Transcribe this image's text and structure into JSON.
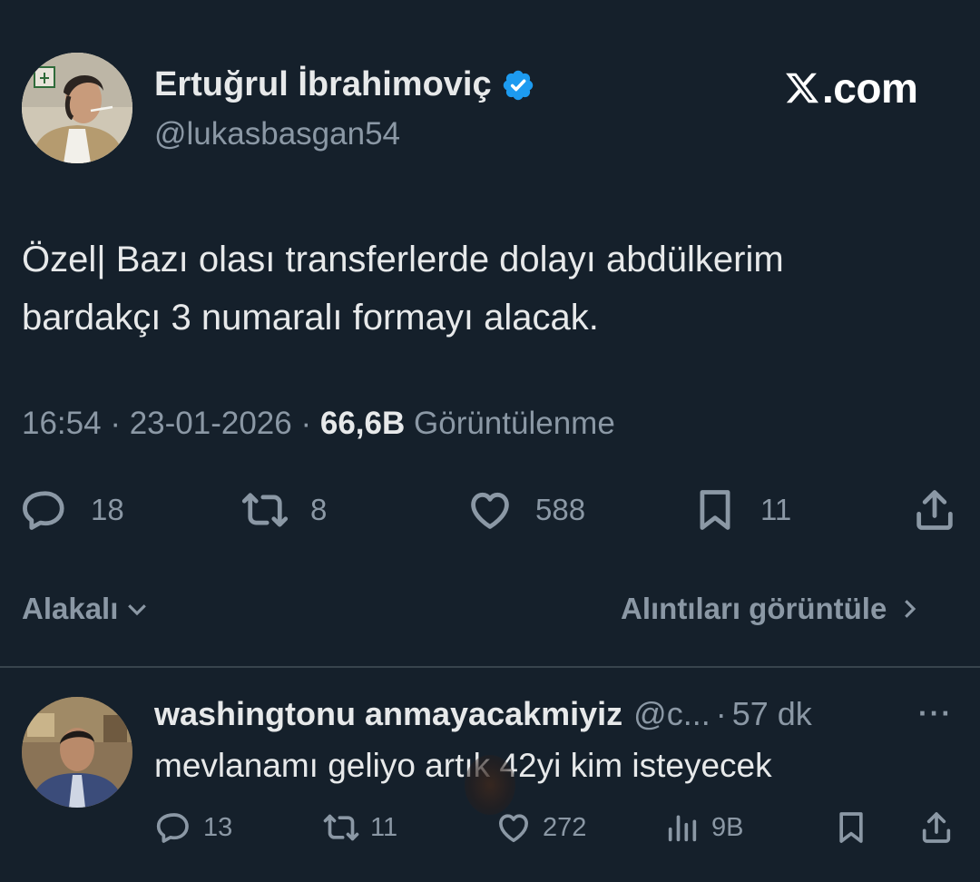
{
  "tweet": {
    "author_name": "Ertuğrul İbrahimoviç",
    "author_handle": "@lukasbasgan54",
    "brand": ".com",
    "brand_icon": "x-logo-icon",
    "text": "Özel| Bazı olası transferlerde dolayı abdülkerim\nbardakçı 3 numaralı formayı alacak.",
    "time": "16:54",
    "separator": " · ",
    "date": "23-01-2026",
    "views_count": "66,6B",
    "views_label": "Görüntülenme",
    "actions": {
      "replies": "18",
      "retweets": "8",
      "likes": "588",
      "bookmarks": "11"
    }
  },
  "filters": {
    "related_label": "Alakalı",
    "quotes_label": "Alıntıları görüntüle"
  },
  "reply": {
    "name": "washingtonu anmayacakmiyiz",
    "handle": "@c...",
    "dot": "·",
    "time": "57 dk",
    "more": "···",
    "text": "mevlanamı geliyo artık 42yi kim isteyecek",
    "actions": {
      "replies": "13",
      "retweets": "11",
      "likes": "272",
      "views": "9B"
    }
  },
  "colors": {
    "background": "#15202b",
    "text": "#e7e9ea",
    "muted": "#8b98a5",
    "verified": "#1d9bf0",
    "divider": "#38444d"
  }
}
